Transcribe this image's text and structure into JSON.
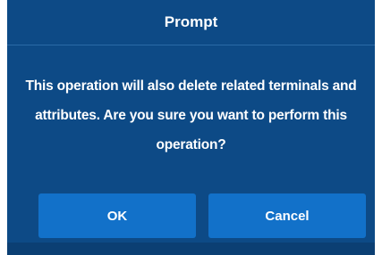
{
  "dialog": {
    "title": "Prompt",
    "message": "This operation will also delete related terminals and attributes. Are you sure you want to perform this operation?",
    "ok_label": "OK",
    "cancel_label": "Cancel"
  },
  "colors": {
    "dialog_background": "#0d4a86",
    "button_background": "#1271c9",
    "text": "#ffffff"
  }
}
